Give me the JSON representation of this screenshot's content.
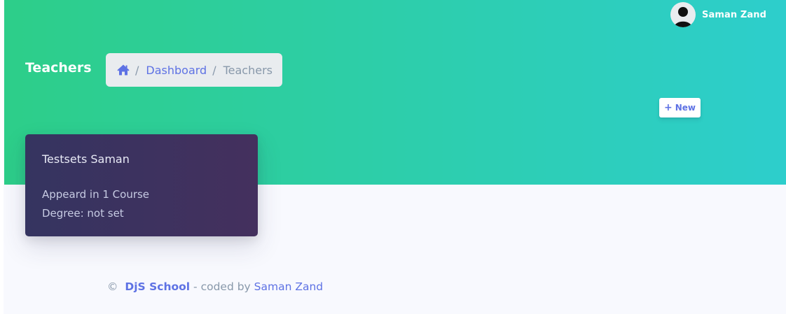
{
  "header": {
    "user_name": "Saman Zand",
    "page_title": "Teachers",
    "breadcrumb": {
      "home_icon": "home-icon",
      "separator": "/",
      "items": [
        "Dashboard",
        "Teachers"
      ]
    },
    "new_button": {
      "icon": "plus-icon",
      "icon_glyph": "+",
      "label": "New"
    }
  },
  "teacher_card": {
    "name": "Testsets Saman",
    "appears": "Appeard in 1 Course",
    "degree": "Degree: not set"
  },
  "footer": {
    "copyright": "©",
    "brand": "DjS School",
    "middle": "- coded by",
    "author": "Saman Zand"
  },
  "colors": {
    "gradient_start": "#2dce89",
    "gradient_end": "#2dcecc",
    "primary": "#5e72e4",
    "card_dark": "#3a335f",
    "muted": "#8898aa",
    "body_bg": "#f8f9fe"
  }
}
